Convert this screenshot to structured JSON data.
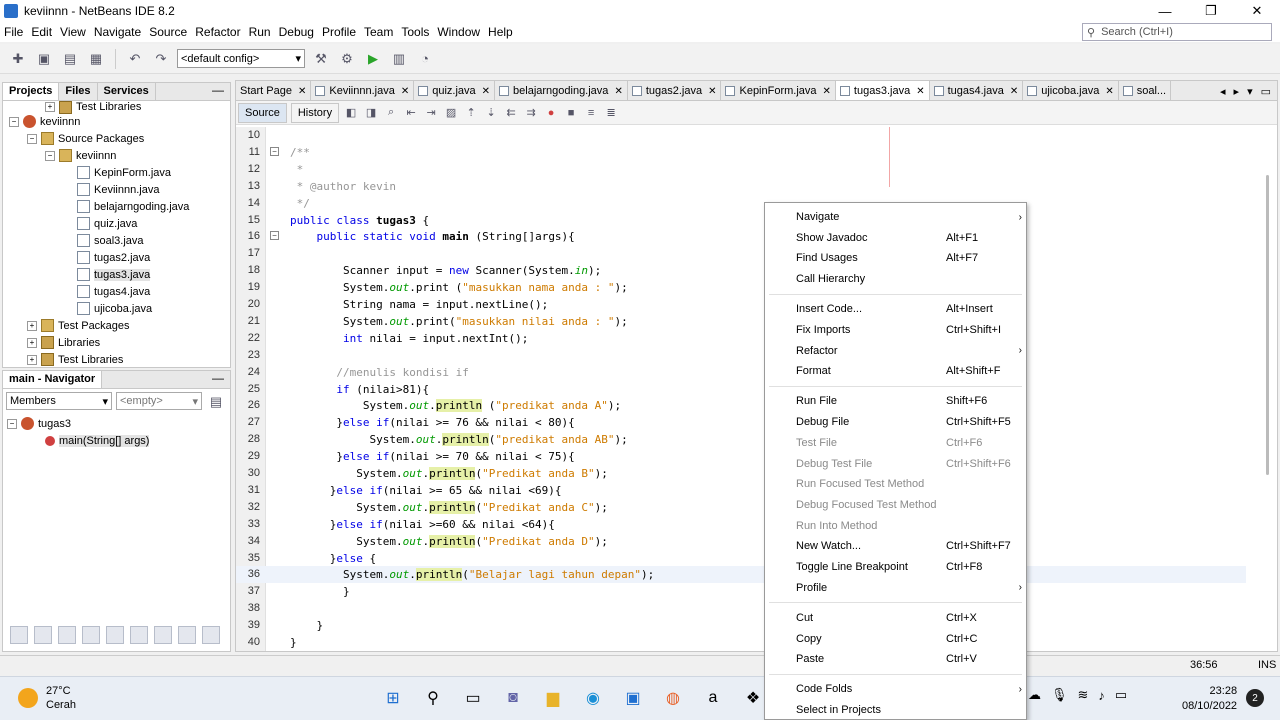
{
  "window": {
    "title": "keviinnn - NetBeans IDE 8.2",
    "controls": [
      "—",
      "❐",
      "✕"
    ]
  },
  "menubar": [
    "File",
    "Edit",
    "View",
    "Navigate",
    "Source",
    "Refactor",
    "Run",
    "Debug",
    "Profile",
    "Team",
    "Tools",
    "Window",
    "Help"
  ],
  "search": {
    "placeholder": "Search (Ctrl+I)"
  },
  "toolbar": {
    "config": "<default config>"
  },
  "projects_panel": {
    "tabs": [
      "Projects",
      "Files",
      "Services"
    ],
    "tree": [
      {
        "label": "Test Libraries",
        "indent": 2,
        "icon": "lib",
        "exp": "+"
      },
      {
        "label": "keviinnn",
        "indent": 0,
        "icon": "proj",
        "exp": "−"
      },
      {
        "label": "Source Packages",
        "indent": 1,
        "icon": "pkg",
        "exp": "−"
      },
      {
        "label": "keviinnn",
        "indent": 2,
        "icon": "pkg",
        "exp": "−"
      },
      {
        "label": "KepinForm.java",
        "indent": 3,
        "icon": "file"
      },
      {
        "label": "Keviinnn.java",
        "indent": 3,
        "icon": "file"
      },
      {
        "label": "belajarngoding.java",
        "indent": 3,
        "icon": "file"
      },
      {
        "label": "quiz.java",
        "indent": 3,
        "icon": "file"
      },
      {
        "label": "soal3.java",
        "indent": 3,
        "icon": "file"
      },
      {
        "label": "tugas2.java",
        "indent": 3,
        "icon": "file"
      },
      {
        "label": "tugas3.java",
        "indent": 3,
        "icon": "file",
        "selected": true
      },
      {
        "label": "tugas4.java",
        "indent": 3,
        "icon": "file"
      },
      {
        "label": "ujicoba.java",
        "indent": 3,
        "icon": "file"
      },
      {
        "label": "Test Packages",
        "indent": 1,
        "icon": "pkg",
        "exp": "+"
      },
      {
        "label": "Libraries",
        "indent": 1,
        "icon": "lib",
        "exp": "+"
      },
      {
        "label": "Test Libraries",
        "indent": 1,
        "icon": "lib",
        "exp": "+"
      }
    ]
  },
  "navigator": {
    "title": "main - Navigator",
    "filter1": "Members",
    "filter2": "<empty>",
    "class_name": "tugas3",
    "method": "main(String[] args)"
  },
  "editor": {
    "tabs": [
      "Start Page",
      "Keviinnn.java",
      "quiz.java",
      "belajarngoding.java",
      "tugas2.java",
      "KepinForm.java",
      "tugas3.java",
      "tugas4.java",
      "ujicoba.java",
      "soal..."
    ],
    "active_tab": "tugas3.java",
    "modes": [
      "Source",
      "History"
    ]
  },
  "status": {
    "position": "36:56",
    "mode": "INS"
  },
  "taskbar": {
    "temp": "27°C",
    "weather": "Cerah",
    "time": "23:28",
    "date": "08/10/2022",
    "notifications": "2"
  },
  "context_menu": [
    {
      "label": "Navigate",
      "shortcut": "",
      "submenu": true
    },
    {
      "label": "Show Javadoc",
      "shortcut": "Alt+F1"
    },
    {
      "label": "Find Usages",
      "shortcut": "Alt+F7"
    },
    {
      "label": "Call Hierarchy",
      "shortcut": ""
    },
    {
      "sep": true
    },
    {
      "label": "Insert Code...",
      "shortcut": "Alt+Insert"
    },
    {
      "label": "Fix Imports",
      "shortcut": "Ctrl+Shift+I"
    },
    {
      "label": "Refactor",
      "shortcut": "",
      "submenu": true
    },
    {
      "label": "Format",
      "shortcut": "Alt+Shift+F"
    },
    {
      "sep": true
    },
    {
      "label": "Run File",
      "shortcut": "Shift+F6"
    },
    {
      "label": "Debug File",
      "shortcut": "Ctrl+Shift+F5"
    },
    {
      "label": "Test File",
      "shortcut": "Ctrl+F6",
      "disabled": true
    },
    {
      "label": "Debug Test File",
      "shortcut": "Ctrl+Shift+F6",
      "disabled": true
    },
    {
      "label": "Run Focused Test Method",
      "shortcut": "",
      "disabled": true
    },
    {
      "label": "Debug Focused Test Method",
      "shortcut": "",
      "disabled": true
    },
    {
      "label": "Run Into Method",
      "shortcut": "",
      "disabled": true
    },
    {
      "label": "New Watch...",
      "shortcut": "Ctrl+Shift+F7"
    },
    {
      "label": "Toggle Line Breakpoint",
      "shortcut": "Ctrl+F8"
    },
    {
      "label": "Profile",
      "shortcut": "",
      "submenu": true
    },
    {
      "sep": true
    },
    {
      "label": "Cut",
      "shortcut": "Ctrl+X"
    },
    {
      "label": "Copy",
      "shortcut": "Ctrl+C"
    },
    {
      "label": "Paste",
      "shortcut": "Ctrl+V"
    },
    {
      "sep": true
    },
    {
      "label": "Code Folds",
      "shortcut": "",
      "submenu": true
    },
    {
      "label": "Select in Projects",
      "shortcut": ""
    }
  ],
  "code": [
    {
      "n": "10",
      "h": ""
    },
    {
      "n": "11",
      "fold": "−",
      "h": "<span class='cm'>/**</span>"
    },
    {
      "n": "12",
      "h": "<span class='cm'> *</span>"
    },
    {
      "n": "13",
      "h": "<span class='cm'> * @author kevin</span>"
    },
    {
      "n": "14",
      "h": "<span class='cm'> */</span>"
    },
    {
      "n": "15",
      "h": "<span class='kw'>public class</span> <span class='mth'>tugas3</span> {"
    },
    {
      "n": "16",
      "fold": "−",
      "h": "    <span class='kw'>public static void</span> <span class='mth'>main</span> (String[]args){"
    },
    {
      "n": "17",
      "h": ""
    },
    {
      "n": "18",
      "h": "        Scanner input = <span class='kw'>new</span> Scanner(System.<span class='fld'>in</span>);"
    },
    {
      "n": "19",
      "h": "        System.<span class='fld'>out</span>.print (<span class='st'>\"masukkan nama anda : \"</span>);"
    },
    {
      "n": "20",
      "h": "        String nama = input.nextLine();"
    },
    {
      "n": "21",
      "h": "        System.<span class='fld'>out</span>.print(<span class='st'>\"masukkan nilai anda : \"</span>);"
    },
    {
      "n": "22",
      "h": "        <span class='kw'>int</span> nilai = input.nextInt();"
    },
    {
      "n": "23",
      "h": ""
    },
    {
      "n": "24",
      "h": "       <span class='cm'>//menulis kondisi if</span>"
    },
    {
      "n": "25",
      "h": "       <span class='kw'>if</span> (nilai&gt;81){"
    },
    {
      "n": "26",
      "h": "           System.<span class='fld'>out</span>.<span class='hl'>println</span> (<span class='st'>\"predikat anda A\"</span>);"
    },
    {
      "n": "27",
      "h": "       }<span class='kw'>else if</span>(nilai &gt;= 76 &amp;&amp; nilai &lt; 80){"
    },
    {
      "n": "28",
      "h": "            System.<span class='fld'>out</span>.<span class='hl'>println</span>(<span class='st'>\"predikat anda AB\"</span>);"
    },
    {
      "n": "29",
      "h": "       }<span class='kw'>else if</span>(nilai &gt;= 70 &amp;&amp; nilai &lt; 75){"
    },
    {
      "n": "30",
      "h": "          System.<span class='fld'>out</span>.<span class='hl'>println</span>(<span class='st'>\"Predikat anda B\"</span>);"
    },
    {
      "n": "31",
      "h": "      }<span class='kw'>else if</span>(nilai &gt;= 65 &amp;&amp; nilai &lt;69){"
    },
    {
      "n": "32",
      "h": "          System.<span class='fld'>out</span>.<span class='hl'>println</span>(<span class='st'>\"Predikat anda C\"</span>);"
    },
    {
      "n": "33",
      "h": "      }<span class='kw'>else if</span>(nilai &gt;=60 &amp;&amp; nilai &lt;64){"
    },
    {
      "n": "34",
      "h": "          System.<span class='fld'>out</span>.<span class='hl'>println</span>(<span class='st'>\"Predikat anda D\"</span>);"
    },
    {
      "n": "35",
      "h": "      }<span class='kw'>else</span> {"
    },
    {
      "n": "36",
      "current": true,
      "h": "        System.<span class='fld'>out</span>.<span class='hl'>println</span>(<span class='st'>\"Belajar lagi tahun depan\"</span>);"
    },
    {
      "n": "37",
      "h": "        }"
    },
    {
      "n": "38",
      "h": ""
    },
    {
      "n": "39",
      "h": "    }"
    },
    {
      "n": "40",
      "h": "}"
    }
  ]
}
